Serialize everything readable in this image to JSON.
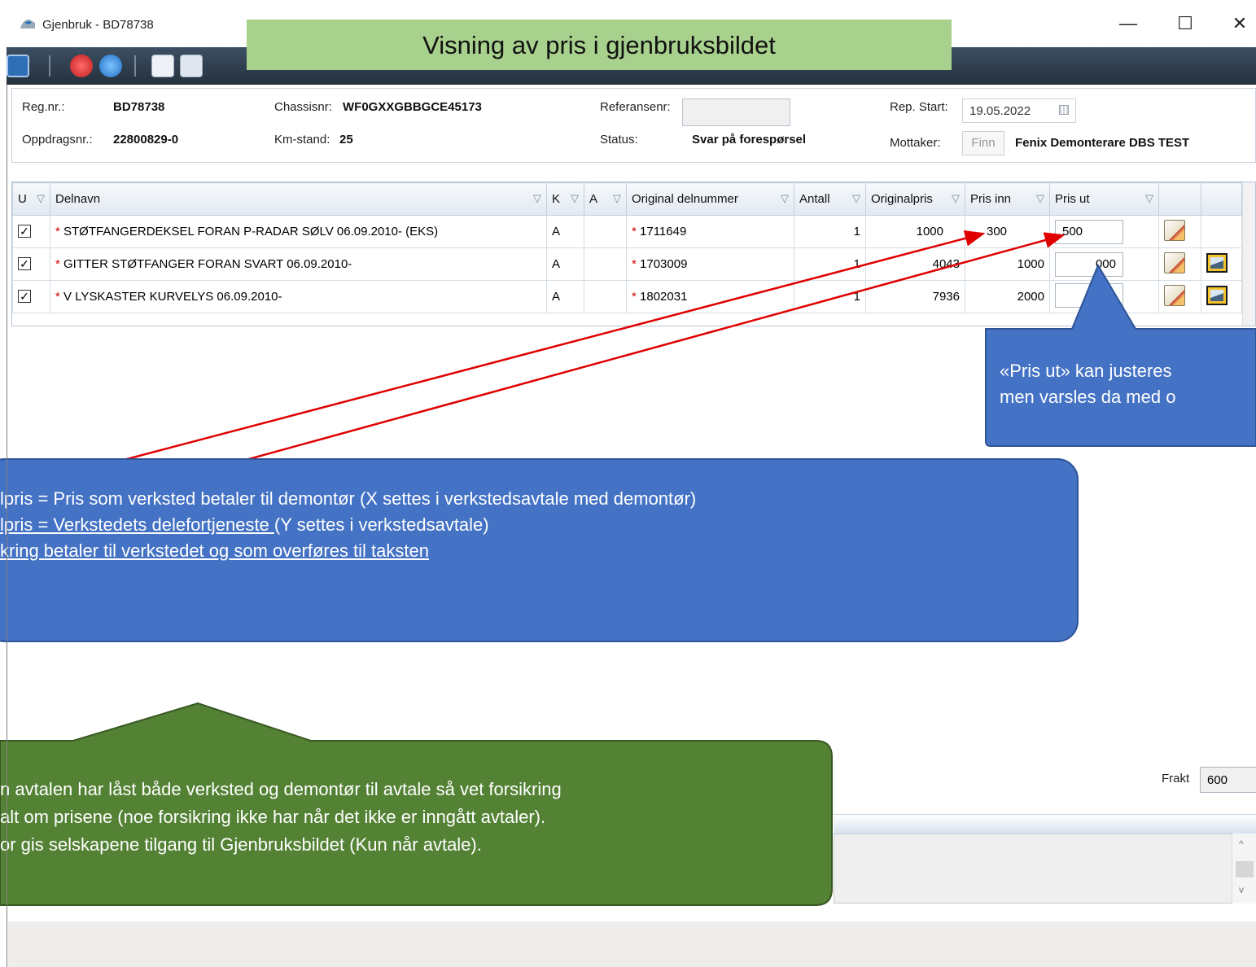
{
  "window": {
    "title": "Gjenbruk - BD78738",
    "minimize": "—",
    "maximize": "☐",
    "close": "✕"
  },
  "banner": "Visning av pris i gjenbruksbildet",
  "header": {
    "reg_label": "Reg.nr.:",
    "reg_value": "BD78738",
    "chassis_label": "Chassisnr:",
    "chassis_value": "WF0GXXGBBGCE45173",
    "ref_label": "Referansenr:",
    "rep_label": "Rep. Start:",
    "rep_value": "19.05.2022",
    "oppdrag_label": "Oppdragsnr.:",
    "oppdrag_value": "22800829-0",
    "km_label": "Km-stand:",
    "km_value": "25",
    "status_label": "Status:",
    "status_value": "Svar på forespørsel",
    "mottaker_label": "Mottaker:",
    "finn_button": "Finn",
    "mottaker_value": "Fenix Demonterare DBS TEST"
  },
  "grid": {
    "columns": [
      "U",
      "Delnavn",
      "K",
      "A",
      "Original delnummer",
      "Antall",
      "Originalpris",
      "Pris inn",
      "Pris ut"
    ],
    "rows": [
      {
        "checked": "✓",
        "delnavn": "STØTFANGERDEKSEL FORAN P-RADAR SØLV 06.09.2010- (EKS)",
        "k": "A",
        "a": "",
        "delnummer": "1711649",
        "antall": "1",
        "originalpris": "1000",
        "pris_inn": "300",
        "pris_ut": "500"
      },
      {
        "checked": "✓",
        "delnavn": "GITTER STØTFANGER FORAN SVART 06.09.2010-",
        "k": "A",
        "a": "",
        "delnummer": "1703009",
        "antall": "1",
        "originalpris": "4043",
        "pris_inn": "1000",
        "pris_ut": "000"
      },
      {
        "checked": "✓",
        "delnavn": "V LYSKASTER KURVELYS 06.09.2010-",
        "k": "A",
        "a": "",
        "delnummer": "1802031",
        "antall": "1",
        "originalpris": "7936",
        "pris_inn": "2000",
        "pris_ut": ""
      }
    ]
  },
  "callouts": {
    "right": {
      "line1": "«Pris ut» kan justeres",
      "line2": "men varsles da med o"
    },
    "middle": {
      "line1": "lpris = Pris som verksted betaler til demontør (X settes i verkstedsavtale med demontør)",
      "line2_u": "lpris = Verkstedets delefortjeneste ",
      "line2_rest": "(Y settes i verkstedsavtale)",
      "line3": "kring betaler til verkstedet og som overføres til taksten"
    },
    "bottom": {
      "line1": "n avtalen har låst både verksted og demontør til avtale så vet forsikring",
      "line2": "alt om prisene (noe forsikring ikke har når det ikke er  inngått avtaler).",
      "line3": "or gis selskapene tilgang til Gjenbruksbildet (Kun når avtale)."
    }
  },
  "frakt": {
    "label": "Frakt",
    "value": "600"
  },
  "colors": {
    "banner": "#a9d18e",
    "callout_blue": "#4472c4",
    "callout_green": "#548235",
    "arrow": "#e00000",
    "toolbar": "#2f3d4c"
  },
  "icons": [
    "app-icon",
    "save-icon",
    "reject-icon",
    "download-icon",
    "mail-add-icon",
    "mail-transfer-icon",
    "filter-icon",
    "checkbox-icon",
    "note-edit-icon",
    "image-icon",
    "calendar-icon"
  ]
}
